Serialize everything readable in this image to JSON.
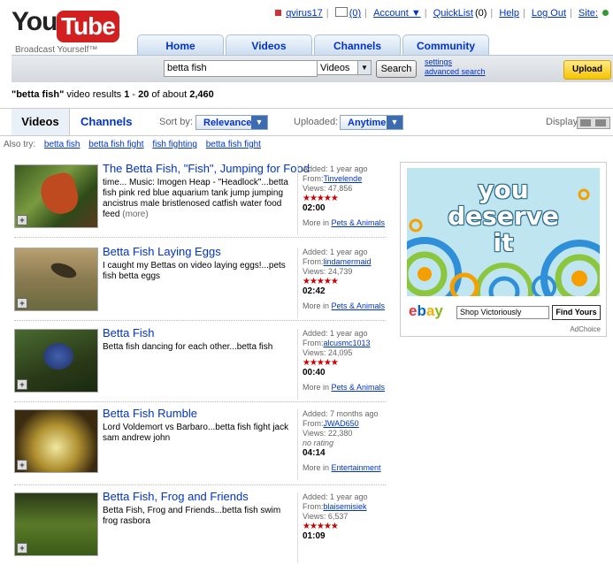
{
  "brand": {
    "you": "You",
    "tube": "Tube",
    "tagline": "Broadcast Yourself™"
  },
  "util": {
    "user": "qvirus17",
    "inbox": "(0)",
    "account": "Account ▼",
    "quicklist": "QuickList",
    "quicklist_count": "(0)",
    "help": "Help",
    "logout": "Log Out",
    "site": "Site:"
  },
  "nav": {
    "home": "Home",
    "videos": "Videos",
    "channels": "Channels",
    "community": "Community"
  },
  "search": {
    "value": "betta fish",
    "scope": "Videos",
    "button": "Search",
    "settings": "settings",
    "advanced": "advanced search",
    "upload": "Upload"
  },
  "summary": {
    "query": "\"betta fish\"",
    "text1": " video results ",
    "range_start": "1",
    "dash": " - ",
    "range_end": "20",
    "text2": " of about ",
    "total": "2,460"
  },
  "filters": {
    "videos": "Videos",
    "channels": "Channels",
    "sort_label": "Sort by:",
    "sort_value": "Relevance",
    "uploaded_label": "Uploaded:",
    "uploaded_value": "Anytime",
    "display_label": "Display:"
  },
  "also_try": {
    "label": "Also try:",
    "items": [
      "betta fish",
      "betta fish fight",
      "fish fighting",
      "betta fish fight"
    ]
  },
  "results": [
    {
      "title": "The Betta Fish, \"Fish\", Jumping for Food",
      "desc": "time... Music: Imogen Heap - \"Headlock\"...betta fish pink red blue aquarium tank jump jumping ancistrus male bristlenosed catfish water food feed",
      "more": "(more)",
      "added": "Added: 1 year ago",
      "from_label": "From:",
      "from": "Tinvelende",
      "views": "Views: 47,856",
      "rating": 4.5,
      "stars": "★★★★★",
      "duration": "02:00",
      "more_in": "More in ",
      "category": "Pets & Animals"
    },
    {
      "title": "Betta Fish Laying Eggs",
      "desc": "I caught my Bettas on video laying eggs!...pets fish betta eggs",
      "more": "",
      "added": "Added: 1 year ago",
      "from_label": "From:",
      "from": "lindamermaid",
      "views": "Views: 24,739",
      "rating": 4.5,
      "stars": "★★★★★",
      "duration": "02:42",
      "more_in": "More in ",
      "category": "Pets & Animals"
    },
    {
      "title": "Betta Fish",
      "desc": "Betta fish dancing for each other...betta fish",
      "more": "",
      "added": "Added: 1 year ago",
      "from_label": "From:",
      "from": "alcusmc1013",
      "views": "Views: 24,095",
      "rating": 5,
      "stars": "★★★★★",
      "duration": "00:40",
      "more_in": "More in ",
      "category": "Pets & Animals"
    },
    {
      "title": "Betta Fish Rumble",
      "desc": "Lord Voldemort vs Barbaro...betta fish fight jack sam andrew john",
      "more": "",
      "added": "Added: 7 months ago",
      "from_label": "From:",
      "from": "JWAD650",
      "views": "Views: 22,380",
      "rating_text": "no rating",
      "duration": "04:14",
      "more_in": "More in ",
      "category": "Entertainment"
    },
    {
      "title": "Betta Fish, Frog and Friends",
      "desc": "Betta Fish, Frog and Friends...betta fish swim frog rasbora",
      "more": "",
      "added": "Added: 1 year ago",
      "from_label": "From:",
      "from": "blaisemisiek",
      "views": "Views: 6,537",
      "rating": 4.5,
      "stars": "★★★★★",
      "duration": "01:09"
    }
  ],
  "ad": {
    "line1": "you",
    "line2": "deserve",
    "line3": "it",
    "logo": "ebay",
    "input": "Shop Victoriously",
    "button": "Find Yours",
    "choice": "AdChoice"
  },
  "colors": {
    "link": "#0033cc",
    "brand_red": "#d21f1f",
    "star_red": "#cc0000",
    "upload_yellow": "#f5c400"
  }
}
